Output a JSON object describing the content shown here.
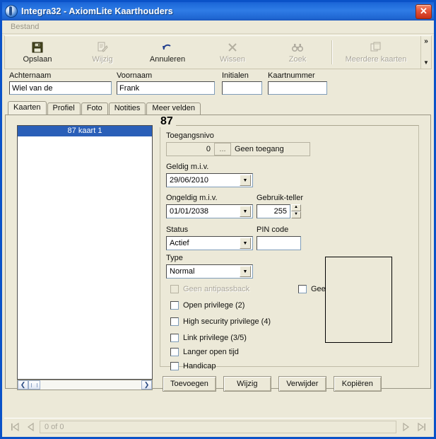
{
  "window": {
    "title": "Integra32 - AxiomLite Kaarthouders",
    "icon": "globe-icon",
    "close_label": "✕",
    "accent": "#1d69d9"
  },
  "menu": {
    "items": [
      {
        "label": "Bestand"
      }
    ]
  },
  "toolbar": {
    "buttons": [
      {
        "label": "Opslaan",
        "icon": "save-icon",
        "enabled": true
      },
      {
        "label": "Wijzig",
        "icon": "edit-icon",
        "enabled": false
      },
      {
        "label": "Annuleren",
        "icon": "undo-icon",
        "enabled": true
      },
      {
        "label": "Wissen",
        "icon": "delete-x-icon",
        "enabled": false
      },
      {
        "label": "Zoek",
        "icon": "binoculars-icon",
        "enabled": false
      },
      {
        "label": "Meerdere kaarten",
        "icon": "copy-cards-icon",
        "enabled": false
      }
    ],
    "overflow_chevron": "»",
    "overflow_down": "▼"
  },
  "person": {
    "fields": [
      {
        "label": "Achternaam",
        "value": "Wiel van de",
        "placeholder": ""
      },
      {
        "label": "Voornaam",
        "value": "Frank",
        "placeholder": ""
      },
      {
        "label": "Initialen",
        "value": "",
        "placeholder": ""
      },
      {
        "label": "Kaartnummer",
        "value": "",
        "placeholder": ""
      }
    ]
  },
  "tabs": {
    "items": [
      {
        "label": "Kaarten",
        "active": true
      },
      {
        "label": "Profiel",
        "active": false
      },
      {
        "label": "Foto",
        "active": false
      },
      {
        "label": "Notities",
        "active": false
      },
      {
        "label": "Meer velden",
        "active": false
      }
    ]
  },
  "card_list": {
    "rows": [
      {
        "text": "87  kaart 1",
        "selected": true
      }
    ],
    "scroll_left": "❮",
    "scroll_right": "❯"
  },
  "card_detail": {
    "group_title": "87",
    "access_level": {
      "label": "Toegangsnivo",
      "value": "0",
      "browse_label": "...",
      "description": "Geen toegang"
    },
    "valid_from": {
      "label": "Geldig m.i.v.",
      "value": "29/06/2010"
    },
    "valid_to": {
      "label": "Ongeldig m.i.v.",
      "value": "01/01/2038"
    },
    "use_counter": {
      "label": "Gebruik-teller",
      "value": "255",
      "up": "▲",
      "down": "▼"
    },
    "status": {
      "label": "Status",
      "value": "Actief"
    },
    "pin": {
      "label": "PIN code",
      "value": ""
    },
    "type": {
      "label": "Type",
      "value": "Normal"
    },
    "checkboxes_left": [
      {
        "label": "Geen antipassback",
        "checked": false,
        "enabled": false
      },
      {
        "label": "Open privilege (2)",
        "checked": false,
        "enabled": true
      },
      {
        "label": "High security privilege (4)",
        "checked": false,
        "enabled": true
      },
      {
        "label": "Link privilege (3/5)",
        "checked": false,
        "enabled": true
      },
      {
        "label": "Langer open tijd",
        "checked": false,
        "enabled": true
      },
      {
        "label": "Handicap",
        "checked": false,
        "enabled": true
      }
    ],
    "checkboxes_right": [
      {
        "label": "Geen auto deactiveren",
        "checked": false,
        "enabled": true
      }
    ],
    "photo_placeholder": ""
  },
  "card_buttons": [
    {
      "label": "Toevoegen"
    },
    {
      "label": "Wijzig"
    },
    {
      "label": "Verwijder"
    },
    {
      "label": "Kopiëren"
    }
  ],
  "navigator": {
    "first": "⏮",
    "prev": "◁",
    "next": "▷",
    "last": "⏭",
    "status": "0 of 0"
  }
}
